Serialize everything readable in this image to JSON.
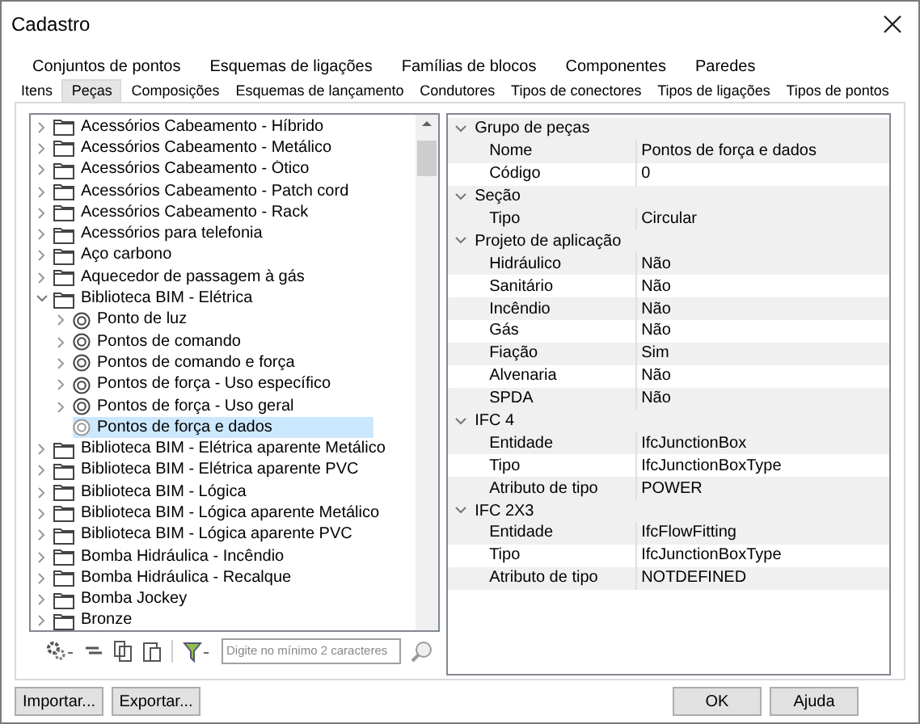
{
  "window": {
    "title": "Cadastro"
  },
  "tab_rows": [
    [
      {
        "label": "Conjuntos de pontos",
        "selected": false
      },
      {
        "label": "Esquemas de ligações",
        "selected": false
      },
      {
        "label": "Famílias de blocos",
        "selected": false
      },
      {
        "label": "Componentes",
        "selected": false
      },
      {
        "label": "Paredes",
        "selected": false
      }
    ],
    [
      {
        "label": "Itens",
        "selected": false
      },
      {
        "label": "Peças",
        "selected": true
      },
      {
        "label": "Composições",
        "selected": false
      },
      {
        "label": "Esquemas de lançamento",
        "selected": false
      },
      {
        "label": "Condutores",
        "selected": false
      },
      {
        "label": "Tipos de conectores",
        "selected": false
      },
      {
        "label": "Tipos de ligações",
        "selected": false
      },
      {
        "label": "Tipos de pontos",
        "selected": false
      }
    ]
  ],
  "tree": [
    {
      "label": "Acessórios Cabeamento - Híbrido",
      "kind": "folder",
      "expandable": true,
      "expanded": false,
      "selected": false
    },
    {
      "label": "Acessórios Cabeamento - Metálico",
      "kind": "folder",
      "expandable": true,
      "expanded": false,
      "selected": false
    },
    {
      "label": "Acessórios Cabeamento - Ótico",
      "kind": "folder",
      "expandable": true,
      "expanded": false,
      "selected": false
    },
    {
      "label": "Acessórios Cabeamento - Patch cord",
      "kind": "folder",
      "expandable": true,
      "expanded": false,
      "selected": false
    },
    {
      "label": "Acessórios Cabeamento - Rack",
      "kind": "folder",
      "expandable": true,
      "expanded": false,
      "selected": false
    },
    {
      "label": "Acessórios para telefonia",
      "kind": "folder",
      "expandable": true,
      "expanded": false,
      "selected": false
    },
    {
      "label": "Aço carbono",
      "kind": "folder",
      "expandable": true,
      "expanded": false,
      "selected": false
    },
    {
      "label": "Aquecedor de passagem à gás",
      "kind": "folder",
      "expandable": true,
      "expanded": false,
      "selected": false
    },
    {
      "label": "Biblioteca BIM - Elétrica",
      "kind": "folder",
      "expandable": true,
      "expanded": true,
      "selected": false,
      "children": [
        {
          "label": "Ponto de luz",
          "kind": "group",
          "expandable": true,
          "expanded": false,
          "selected": false
        },
        {
          "label": "Pontos de comando",
          "kind": "group",
          "expandable": true,
          "expanded": false,
          "selected": false
        },
        {
          "label": "Pontos de comando e força",
          "kind": "group",
          "expandable": true,
          "expanded": false,
          "selected": false
        },
        {
          "label": "Pontos de força - Uso específico",
          "kind": "group",
          "expandable": true,
          "expanded": false,
          "selected": false
        },
        {
          "label": "Pontos de força - Uso geral",
          "kind": "group",
          "expandable": true,
          "expanded": false,
          "selected": false
        },
        {
          "label": "Pontos de força e dados",
          "kind": "group",
          "expandable": false,
          "expanded": false,
          "selected": true
        }
      ]
    },
    {
      "label": "Biblioteca BIM - Elétrica aparente Metálico",
      "kind": "folder",
      "expandable": true,
      "expanded": false,
      "selected": false
    },
    {
      "label": "Biblioteca BIM - Elétrica aparente PVC",
      "kind": "folder",
      "expandable": true,
      "expanded": false,
      "selected": false
    },
    {
      "label": "Biblioteca BIM - Lógica",
      "kind": "folder",
      "expandable": true,
      "expanded": false,
      "selected": false
    },
    {
      "label": "Biblioteca BIM - Lógica aparente Metálico",
      "kind": "folder",
      "expandable": true,
      "expanded": false,
      "selected": false
    },
    {
      "label": "Biblioteca BIM - Lógica aparente PVC",
      "kind": "folder",
      "expandable": true,
      "expanded": false,
      "selected": false
    },
    {
      "label": "Bomba Hidráulica - Incêndio",
      "kind": "folder",
      "expandable": true,
      "expanded": false,
      "selected": false
    },
    {
      "label": "Bomba Hidráulica - Recalque",
      "kind": "folder",
      "expandable": true,
      "expanded": false,
      "selected": false
    },
    {
      "label": "Bomba Jockey",
      "kind": "folder",
      "expandable": true,
      "expanded": false,
      "selected": false
    },
    {
      "label": "Bronze",
      "kind": "folder",
      "expandable": true,
      "expanded": false,
      "selected": false
    }
  ],
  "search": {
    "placeholder": "Digite no mínimo 2 caracteres"
  },
  "properties": [
    {
      "group": "Grupo de peças",
      "expanded": true,
      "rows": [
        {
          "name": "Nome",
          "value": "Pontos de força e dados"
        },
        {
          "name": "Código",
          "value": "0"
        }
      ]
    },
    {
      "group": "Seção",
      "expanded": true,
      "rows": [
        {
          "name": "Tipo",
          "value": "Circular"
        }
      ]
    },
    {
      "group": "Projeto de aplicação",
      "expanded": true,
      "rows": [
        {
          "name": "Hidráulico",
          "value": "Não"
        },
        {
          "name": "Sanitário",
          "value": "Não"
        },
        {
          "name": "Incêndio",
          "value": "Não"
        },
        {
          "name": "Gás",
          "value": "Não"
        },
        {
          "name": "Fiação",
          "value": "Sim"
        },
        {
          "name": "Alvenaria",
          "value": "Não"
        },
        {
          "name": "SPDA",
          "value": "Não"
        }
      ]
    },
    {
      "group": "IFC 4",
      "expanded": true,
      "rows": [
        {
          "name": "Entidade",
          "value": "IfcJunctionBox"
        },
        {
          "name": "Tipo",
          "value": "IfcJunctionBoxType"
        },
        {
          "name": "Atributo de tipo",
          "value": "POWER"
        }
      ]
    },
    {
      "group": "IFC 2X3",
      "expanded": true,
      "rows": [
        {
          "name": "Entidade",
          "value": "IfcFlowFitting"
        },
        {
          "name": "Tipo",
          "value": "IfcJunctionBoxType"
        },
        {
          "name": "Atributo de tipo",
          "value": "NOTDEFINED"
        }
      ]
    }
  ],
  "left_buttons": [
    "Importar...",
    "Exportar..."
  ],
  "right_buttons": [
    "OK",
    "Ajuda"
  ]
}
